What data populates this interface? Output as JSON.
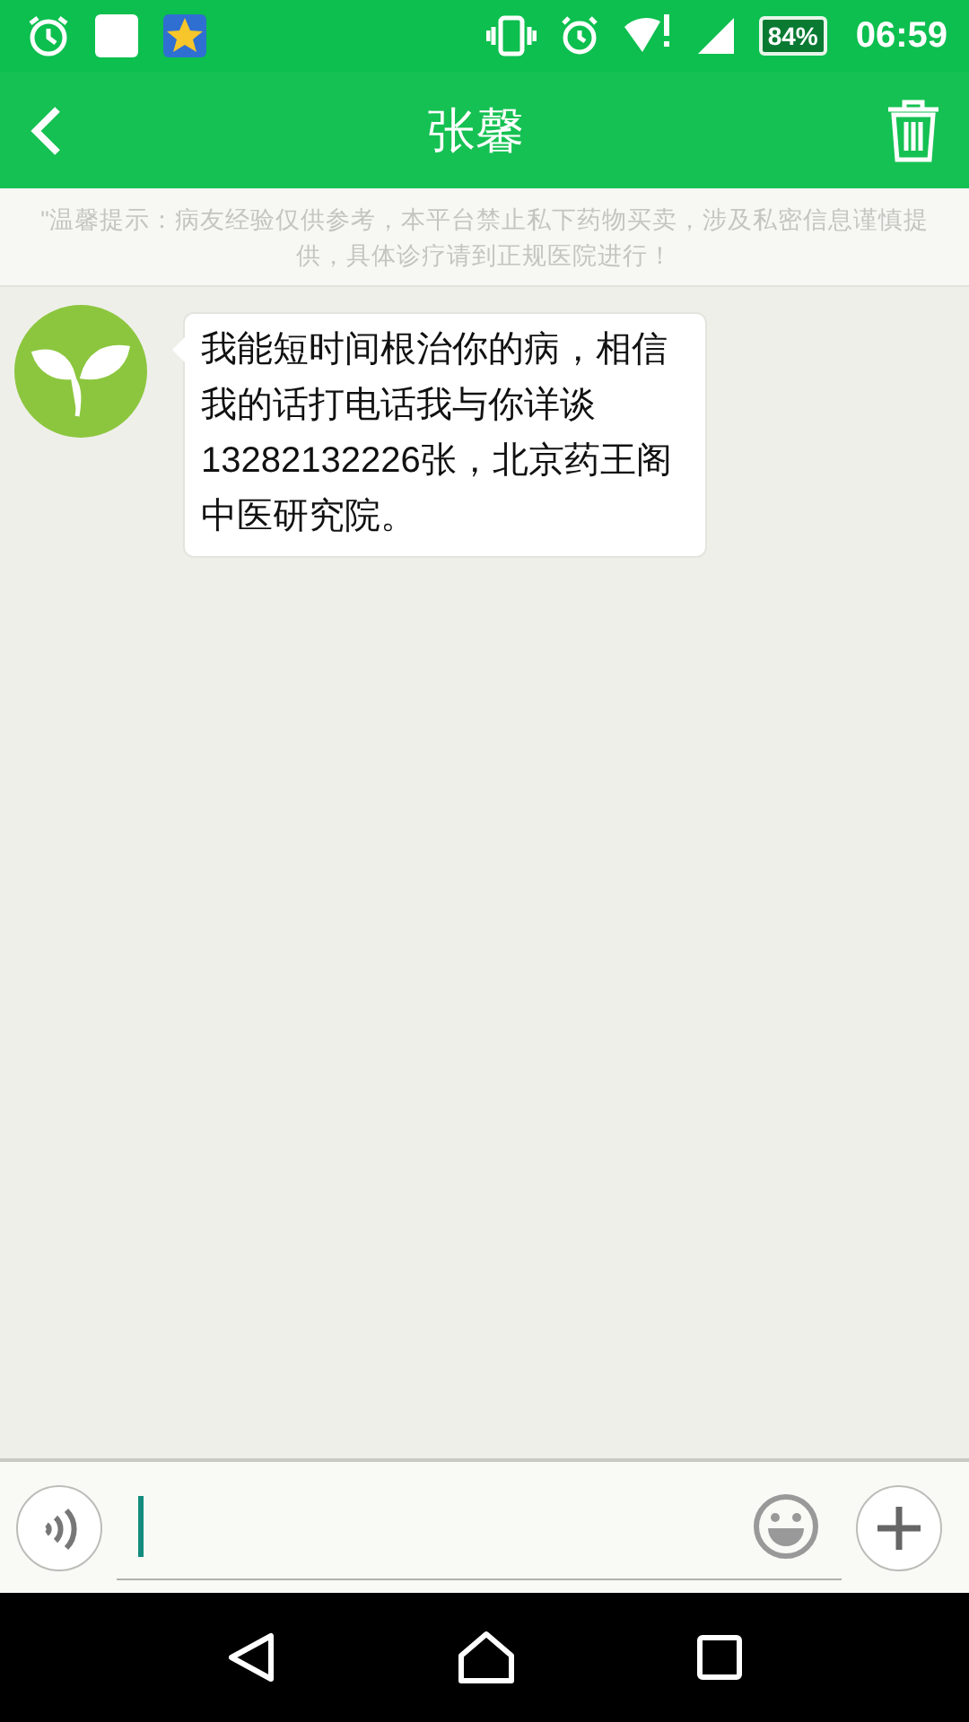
{
  "status_bar": {
    "battery": "84%",
    "time": "06:59"
  },
  "header": {
    "title": "张馨"
  },
  "notice": "\"温馨提示：病友经验仅供参考，本平台禁止私下药物买卖，涉及私密信息谨慎提供，具体诊疗请到正规医院进行！",
  "messages": [
    {
      "kind": "incoming",
      "text": "我能短时间根治你的病，相信我的话打电话我与你详谈13282132226张，北京药王阁中医研究院。"
    }
  ]
}
